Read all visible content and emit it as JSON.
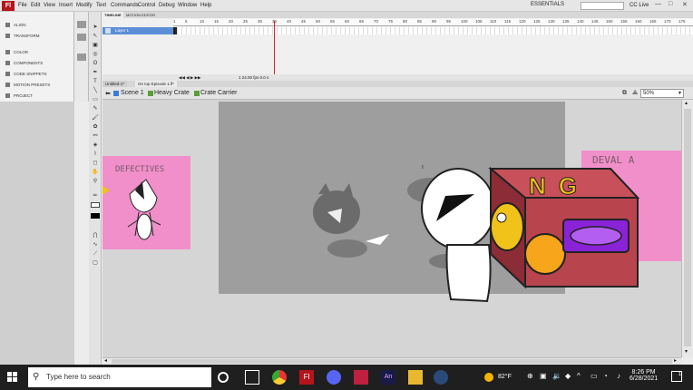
{
  "menubar": {
    "logo": "Fl",
    "items": [
      "File",
      "Edit",
      "View",
      "Insert",
      "Modify",
      "Text",
      "Commands",
      "Control",
      "Debug",
      "Window",
      "Help"
    ],
    "workspace": "ESSENTIALS",
    "cc_live": "CC Live",
    "window_buttons": [
      "—",
      "□",
      "✕"
    ]
  },
  "left_panel": {
    "items": [
      "ALIGN",
      "TRANSFORM",
      "COLOR",
      "COMPONENTS",
      "CODE SNIPPETS",
      "MOTION PRESETS",
      "PROJECT"
    ]
  },
  "timeline": {
    "tabs": [
      "TIMELINE",
      "MOTION EDITOR"
    ],
    "ruler_ticks": [
      "1",
      "5",
      "10",
      "15",
      "20",
      "25",
      "30",
      "35",
      "40",
      "45",
      "50",
      "55",
      "60",
      "65",
      "70",
      "75",
      "80",
      "85",
      "90",
      "95",
      "100",
      "105",
      "110",
      "115",
      "120",
      "125",
      "130",
      "135",
      "140",
      "145",
      "150",
      "155",
      "160",
      "165",
      "170",
      "175"
    ],
    "layer_name": "Layer 1",
    "status": "1    24.00 fps    0.0 s"
  },
  "documents": {
    "tabs": [
      "Untitled-1*",
      "On top Episode 1.fl*"
    ]
  },
  "editbar": {
    "crumbs": [
      "Scene 1",
      "Heavy Crate",
      "Crate Carrier"
    ],
    "zoom": "50%"
  },
  "stage": {
    "left_sign_text": "DEFECTIVES",
    "right_sign_text": "DEVAL  A",
    "crate_text": "NG",
    "colors": {
      "pasteboard": "#d5d5d5",
      "stage": "#9e9e9e",
      "pink": "#f08fc9",
      "crate": "#b8444e",
      "crate_dark": "#8c2c36",
      "gold": "#f0c21a",
      "purple": "#8a22d8"
    }
  },
  "taskbar": {
    "search_placeholder": "Type here to search",
    "weather": "82°F",
    "time": "8:26 PM",
    "date": "6/28/2021",
    "notification_count": "1"
  }
}
